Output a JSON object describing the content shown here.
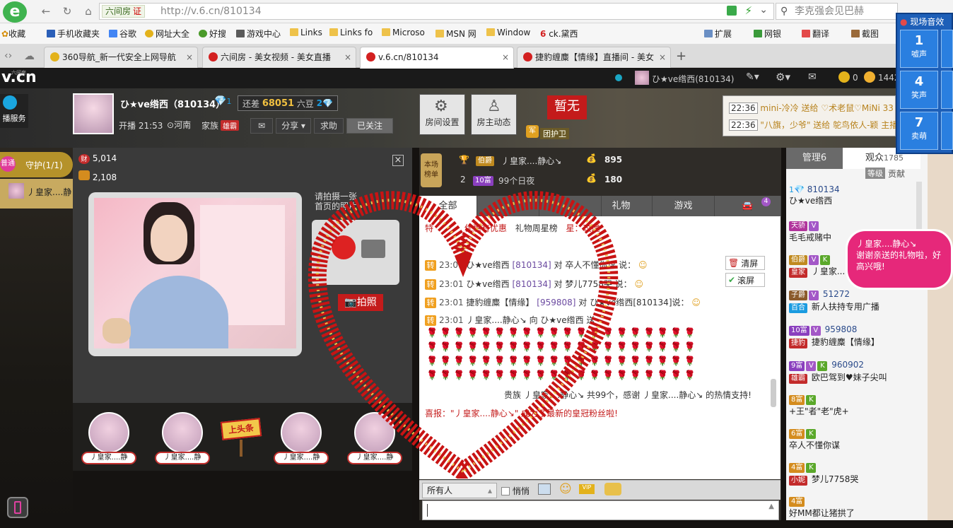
{
  "browser": {
    "nav": {
      "back": "←",
      "forward": "→",
      "refresh": "↻",
      "home": "⌂"
    },
    "site_chip": "六间房",
    "site_chip_badge": "证",
    "url": "http://v.6.cn/810134",
    "search_placeholder": "李克强会见巴赫",
    "favorites": [
      "收藏",
      "手机收藏夹",
      "谷歌",
      "网址大全",
      "好搜",
      "游戏中心",
      "Links",
      "Links fo",
      "Microso",
      "MSN 网",
      "Window",
      "ck.黛西"
    ],
    "fav_right": [
      "扩展",
      "网银",
      "翻译",
      "截图"
    ],
    "tabs": [
      {
        "label": "360导航_新一代安全上网导航",
        "active": false,
        "color": "#e3b21b"
      },
      {
        "label": "六间房 - 美女视频 - 美女直播",
        "active": false,
        "color": "#d32020"
      },
      {
        "label": "v.6.cn/810134",
        "active": true,
        "color": "#d32020"
      },
      {
        "label": "捷豹缠麋【情缘】直播间 - 美女",
        "active": false,
        "color": "#d32020"
      }
    ],
    "new_tab": "+"
  },
  "sound_panel": {
    "title": "现场音效",
    "buttons": [
      {
        "num": "1",
        "label": "嘘声"
      },
      {
        "num": "4",
        "label": "笑声"
      },
      {
        "num": "7",
        "label": "卖萌"
      }
    ]
  },
  "header": {
    "logo": "v.cn",
    "logo_small": "六间房",
    "top_user": "ひ★ve绺西(810134)",
    "coins": "0",
    "beans": "1442",
    "service_label": "播服务"
  },
  "host": {
    "name": "ひ★ve绺西（810134）",
    "diamond": "1",
    "gap_label": "还差",
    "gap_value": "68051",
    "gap_unit": "六豆",
    "gap_level": "2",
    "start_label": "开播",
    "start_time": "21:53",
    "location": "河南",
    "family_label": "家族",
    "family_badge": "雄霸",
    "share": "分享",
    "help": "求助",
    "followed": "已关注"
  },
  "room_buttons": {
    "settings": "房间设置",
    "dynamics": "房主动态"
  },
  "badge_empty": {
    "text": "暂无",
    "label": "团护卫",
    "sub": "军"
  },
  "notify": [
    {
      "time": "22:36",
      "text": "mini-冷冷 送给 ♡术老鼠♡MiNi 33"
    },
    {
      "time": "22:36",
      "text": "\"八旗，少爷\" 送给 鸵鸟依人-颖 主播"
    }
  ],
  "guard": {
    "title": "守护(1/1)",
    "tag": "普通",
    "member": "丿皇家....静"
  },
  "stats": {
    "wealth": "5,014",
    "fans": "2,108"
  },
  "video": {
    "cta_text": "请拍摄一张\n首页的照片",
    "photo_btn": "拍照"
  },
  "vip_seats": [
    "丿皇家....静",
    "丿皇家....静",
    "丿皇家....静",
    "丿皇家....静"
  ],
  "headline_sign": "上头条",
  "rank": {
    "badge_top": "本场",
    "badge_bottom": "榜单",
    "rows": [
      {
        "pos": "",
        "lvl": "伯爵",
        "name": "丿皇家....静心↘",
        "score": "895"
      },
      {
        "pos": "2",
        "lvl": "10富",
        "name": "99个日夜",
        "score": "180"
      }
    ]
  },
  "chat_tabs": [
    "全部",
    "",
    "",
    "礼物",
    "游戏",
    ""
  ],
  "chat_tabs_badge": "4",
  "promo": {
    "left": "特",
    "text1": "优惠有优惠",
    "text2": "礼物周星榜",
    "text3": "星：玫瑰"
  },
  "chat_msgs": [
    {
      "tag": "转",
      "time": "23:01",
      "user": "ひ★ve绺西",
      "uid": "[810134]",
      "text": "对 卒人不懂你谋 说："
    },
    {
      "tag": "转",
      "time": "23:01",
      "user": "ひ★ve绺西",
      "uid": "[810134]",
      "text": "对 梦儿7758哭 说："
    },
    {
      "tag": "转",
      "time": "23:01",
      "user": "捷豹缠麋【情缘】",
      "uid": "[959808]",
      "text": "对 ひ★ve绺西[810134]说："
    },
    {
      "tag": "转",
      "time": "23:01",
      "user": "丿皇家....静心↘",
      "uid": "",
      "text": "向 ひ★ve绺西 送"
    }
  ],
  "chat_thanks": "贵族 丿皇家....静心↘ 共99个，感谢 丿皇家....静心↘ 的热情支持!",
  "chat_news": "喜报：\"丿皇家....静心↘\" 成为了最新的皇冠粉丝啦!",
  "chat_actions": {
    "clear": "清屏",
    "scroll": "滚屏"
  },
  "input_bar": {
    "target": "所有人",
    "whisper": "悄悄"
  },
  "right_tabs": {
    "admin": "管理6",
    "audience": "观众",
    "audience_count": "1785",
    "level": "等级",
    "contrib": "贡献"
  },
  "audience": [
    {
      "lvl": "1",
      "lvl_color": "#3a8fd6",
      "id": "810134",
      "name": "ひ★ve绺西"
    },
    {
      "lvl": "天骄",
      "lvl_color": "#b0339b",
      "id": "",
      "name": "毛毛戒赌中"
    },
    {
      "lvl": "伯爵",
      "lvl_color": "#c08a1f",
      "id": "",
      "name": "丿皇家....静"
    },
    {
      "lvl": "子爵",
      "lvl_color": "#8b5a2b",
      "id": "51272",
      "name": "新人扶持专用广播"
    },
    {
      "lvl": "10富",
      "lvl_color": "#8a3fbe",
      "id": "959808",
      "name": "捷豹缠麋【情缘】"
    },
    {
      "lvl": "9富",
      "lvl_color": "#8a3fbe",
      "id": "960902",
      "name": "欧巴驾到♥妹子尖叫"
    },
    {
      "lvl": "8富",
      "lvl_color": "#d48c1e",
      "id": "",
      "name": "+王\"者\"老\"虎+"
    },
    {
      "lvl": "6富",
      "lvl_color": "#d48c1e",
      "id": "",
      "name": "卒人不懂你谋"
    },
    {
      "lvl": "4富",
      "lvl_color": "#d48c1e",
      "id": "",
      "name": "梦儿7758哭"
    },
    {
      "lvl": "4富",
      "lvl_color": "#d48c1e",
      "id": "",
      "name": "好MM都让猪拱了"
    }
  ],
  "audience_extra_badges": [
    "皇家",
    "百合",
    "捷豹",
    "雄霸",
    "小妮"
  ],
  "bubble": "丿皇家....静心↘\n谢谢亲送的礼物啦，好高兴哦!"
}
